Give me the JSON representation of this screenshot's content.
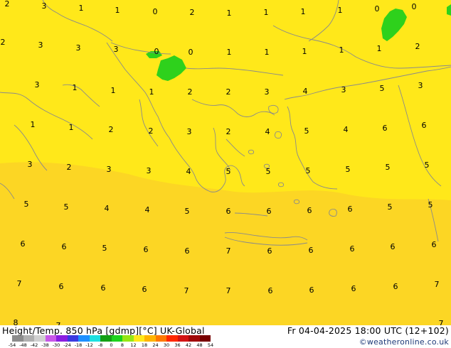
{
  "map": {
    "colors": {
      "main_fill": "#ffe81a",
      "warm_fill": "#fcd624",
      "green_fill": "#2ed11c",
      "coastline": "#8a8a8a"
    },
    "values": [
      "2",
      "3",
      "1",
      "1",
      "0",
      "2",
      "1",
      "1",
      "1",
      "1",
      "0",
      "0",
      "2",
      "3",
      "3",
      "3",
      "0",
      "0",
      "1",
      "1",
      "1",
      "1",
      "1",
      "2",
      "3",
      "1",
      "1",
      "1",
      "2",
      "2",
      "3",
      "4",
      "3",
      "5",
      "3",
      "1",
      "1",
      "2",
      "2",
      "3",
      "2",
      "4",
      "5",
      "4",
      "6",
      "6",
      "3",
      "2",
      "3",
      "3",
      "4",
      "5",
      "5",
      "5",
      "5",
      "5",
      "5",
      "5",
      "5",
      "4",
      "4",
      "5",
      "6",
      "6",
      "6",
      "6",
      "5",
      "5",
      "6",
      "6",
      "5",
      "6",
      "6",
      "7",
      "6",
      "6",
      "6",
      "6",
      "6",
      "7",
      "6",
      "6",
      "6",
      "7",
      "7",
      "6",
      "6",
      "6",
      "6",
      "7",
      "8",
      "7",
      "7"
    ]
  },
  "footer": {
    "left_title": "Height/Temp. 850 hPa [gdmp][°C] UK-Global",
    "right_title": "Fr 04-04-2025 18:00 UTC (12+102)",
    "credit": "©weatheronline.co.uk",
    "scale_ticks": [
      "-54",
      "-48",
      "-42",
      "-38",
      "-30",
      "-24",
      "-18",
      "-12",
      "-8",
      "0",
      "8",
      "12",
      "18",
      "24",
      "30",
      "36",
      "42",
      "48",
      "54"
    ],
    "scale_colors": [
      "#8c8c8c",
      "#b0b0b0",
      "#d0d0d0",
      "#c858e8",
      "#8a1ee0",
      "#3a3ae0",
      "#1e90ff",
      "#1ee0e0",
      "#14a014",
      "#1ed21e",
      "#96e614",
      "#ffe81a",
      "#ffb400",
      "#ff7800",
      "#ff2800",
      "#d21414",
      "#a00a0a",
      "#780000"
    ]
  }
}
